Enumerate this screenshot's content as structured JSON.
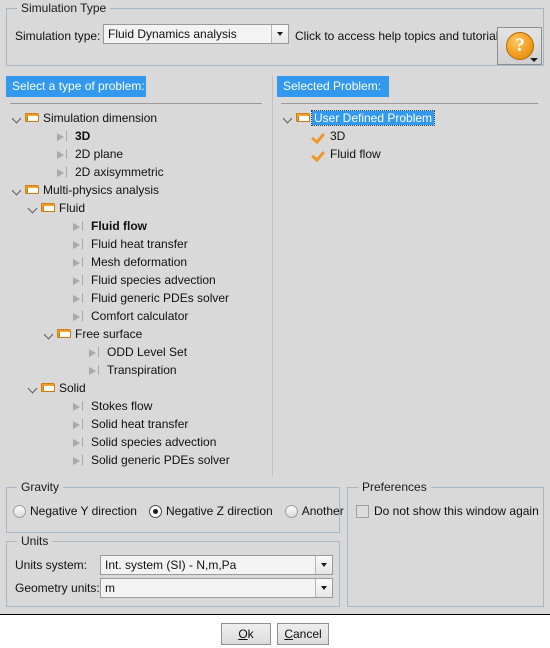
{
  "simulation_type_group": {
    "title": "Simulation Type",
    "label": "Simulation type:",
    "selected": "Fluid Dynamics analysis",
    "help_text": "Click to access help topics and tutorials",
    "help_button_glyph": "?"
  },
  "left_panel": {
    "header": "Select a type of problem:",
    "tree": [
      {
        "label": "Simulation dimension",
        "icon": "folder-open-icon",
        "depth": 0,
        "twisty": "open",
        "bold": false
      },
      {
        "label": "3D",
        "icon": "arrow-item-icon",
        "depth": 2,
        "twisty": "none",
        "bold": true
      },
      {
        "label": "2D plane",
        "icon": "arrow-item-icon",
        "depth": 2,
        "twisty": "none",
        "bold": false
      },
      {
        "label": "2D axisymmetric",
        "icon": "arrow-item-icon",
        "depth": 2,
        "twisty": "none",
        "bold": false
      },
      {
        "label": "Multi-physics analysis",
        "icon": "folder-open-icon",
        "depth": 0,
        "twisty": "open",
        "bold": false
      },
      {
        "label": "Fluid",
        "icon": "folder-open-icon",
        "depth": 1,
        "twisty": "open",
        "bold": false
      },
      {
        "label": "Fluid flow",
        "icon": "arrow-item-icon",
        "depth": 3,
        "twisty": "none",
        "bold": true
      },
      {
        "label": "Fluid heat transfer",
        "icon": "arrow-item-icon",
        "depth": 3,
        "twisty": "none",
        "bold": false
      },
      {
        "label": "Mesh deformation",
        "icon": "arrow-item-icon",
        "depth": 3,
        "twisty": "none",
        "bold": false
      },
      {
        "label": "Fluid species advection",
        "icon": "arrow-item-icon",
        "depth": 3,
        "twisty": "none",
        "bold": false
      },
      {
        "label": "Fluid generic PDEs solver",
        "icon": "arrow-item-icon",
        "depth": 3,
        "twisty": "none",
        "bold": false
      },
      {
        "label": "Comfort calculator",
        "icon": "arrow-item-icon",
        "depth": 3,
        "twisty": "none",
        "bold": false
      },
      {
        "label": "Free surface",
        "icon": "folder-open-icon",
        "depth": 2,
        "twisty": "open",
        "bold": false
      },
      {
        "label": "ODD Level Set",
        "icon": "arrow-item-icon",
        "depth": 4,
        "twisty": "none",
        "bold": false
      },
      {
        "label": "Transpiration",
        "icon": "arrow-item-icon",
        "depth": 4,
        "twisty": "none",
        "bold": false
      },
      {
        "label": "Solid",
        "icon": "folder-open-icon",
        "depth": 1,
        "twisty": "open",
        "bold": false
      },
      {
        "label": "Stokes flow",
        "icon": "arrow-item-icon",
        "depth": 3,
        "twisty": "none",
        "bold": false
      },
      {
        "label": "Solid heat transfer",
        "icon": "arrow-item-icon",
        "depth": 3,
        "twisty": "none",
        "bold": false
      },
      {
        "label": "Solid species advection",
        "icon": "arrow-item-icon",
        "depth": 3,
        "twisty": "none",
        "bold": false
      },
      {
        "label": "Solid generic PDEs solver",
        "icon": "arrow-item-icon",
        "depth": 3,
        "twisty": "none",
        "bold": false
      }
    ]
  },
  "right_panel": {
    "header": "Selected Problem:",
    "tree": [
      {
        "label": "User Defined Problem",
        "icon": "folder-open-icon",
        "depth": 0,
        "twisty": "open",
        "selected": true
      },
      {
        "label": "3D",
        "icon": "check-icon",
        "depth": 1,
        "twisty": "none",
        "selected": false
      },
      {
        "label": "Fluid flow",
        "icon": "check-icon",
        "depth": 1,
        "twisty": "none",
        "selected": false
      }
    ]
  },
  "gravity_group": {
    "title": "Gravity",
    "options": [
      {
        "label": "Negative Y direction",
        "checked": false
      },
      {
        "label": "Negative Z direction",
        "checked": true
      },
      {
        "label": "Another",
        "checked": false
      }
    ]
  },
  "units_group": {
    "title": "Units",
    "units_system_label": "Units system:",
    "units_system_value": "Int. system (SI) - N,m,Pa",
    "geometry_units_label": "Geometry units:",
    "geometry_units_value": "m"
  },
  "preferences_group": {
    "title": "Preferences",
    "checkbox_label": "Do not show this window again",
    "checked": false
  },
  "buttons": {
    "ok_mnemonic": "O",
    "ok_rest": "k",
    "cancel_mnemonic": "C",
    "cancel_rest": "ancel"
  },
  "colors": {
    "header_blue": "#3399ee",
    "accent_orange": "#f0a030",
    "dialog_gray": "#d9d9d9"
  }
}
